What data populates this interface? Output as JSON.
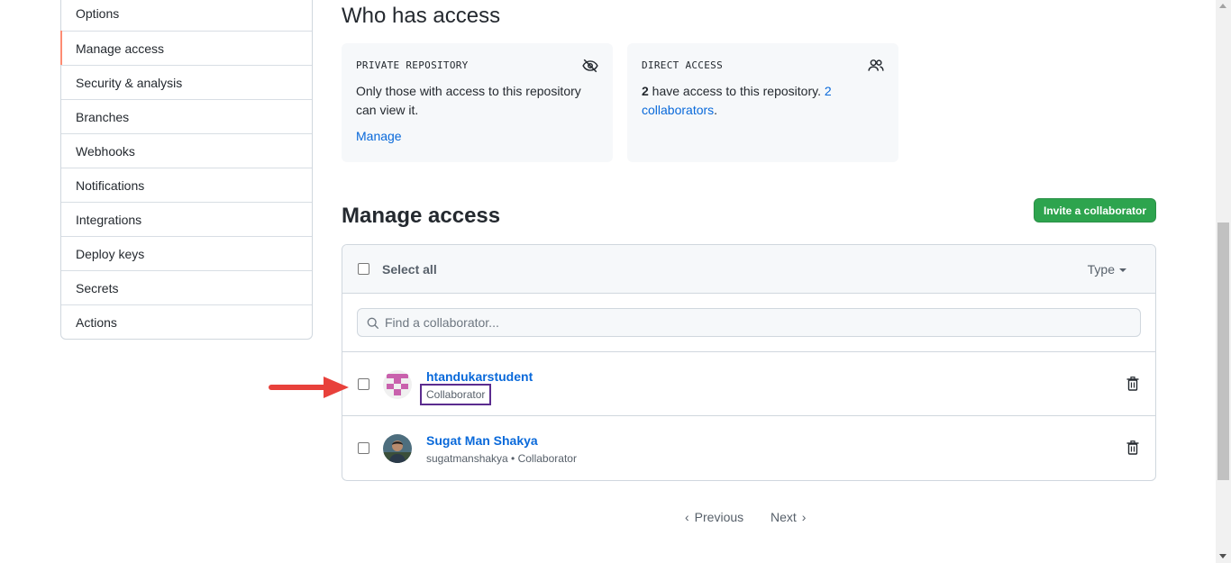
{
  "sidebar": {
    "items": [
      {
        "label": "Options"
      },
      {
        "label": "Manage access"
      },
      {
        "label": "Security & analysis"
      },
      {
        "label": "Branches"
      },
      {
        "label": "Webhooks"
      },
      {
        "label": "Notifications"
      },
      {
        "label": "Integrations"
      },
      {
        "label": "Deploy keys"
      },
      {
        "label": "Secrets"
      },
      {
        "label": "Actions"
      }
    ],
    "active": "Manage access"
  },
  "who_has_access": {
    "title": "Who has access",
    "private_card": {
      "label": "PRIVATE REPOSITORY",
      "icon": "eye-closed-icon",
      "text": "Only those with access to this repository can view it.",
      "link": "Manage"
    },
    "direct_card": {
      "label": "DIRECT ACCESS",
      "icon": "people-icon",
      "count": "2",
      "text": " have access to this repository. ",
      "link": "2 collaborators",
      "suffix": "."
    }
  },
  "manage_access": {
    "title": "Manage access",
    "invite_button": "Invite a collaborator",
    "select_all": "Select all",
    "type_filter": "Type",
    "search_placeholder": "Find a collaborator...",
    "collaborators": [
      {
        "name": "htandukarstudent",
        "role": "Collaborator"
      },
      {
        "name": "Sugat Man Shakya",
        "detail": "sugatmanshakya • Collaborator"
      }
    ]
  },
  "pagination": {
    "previous": "Previous",
    "next": "Next"
  },
  "colors": {
    "link": "#0969da",
    "invite_button": "#2da44e",
    "active_indicator": "#fd8c73",
    "annotation_arrow": "#e8413b",
    "highlight_box": "#5b2c8f"
  }
}
